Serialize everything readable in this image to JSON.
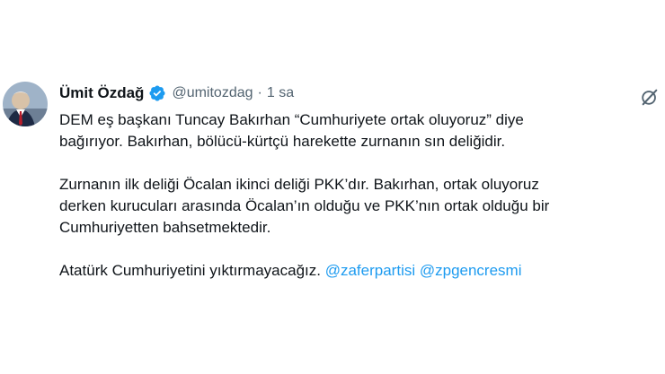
{
  "author": {
    "name": "Ümit Özdağ",
    "handle": "@umitozdag",
    "separator": "·",
    "time": "1 sa",
    "verified_color": "#1d9bf0"
  },
  "icons": {
    "avatar": "avatar-photo",
    "verified": "verified-badge-icon",
    "action": "grok-icon"
  },
  "tweet": {
    "paragraph1": [
      "DEM eş başkanı Tuncay Bakırhan “Cumhuriyete ortak oluyoruz” diye",
      "bağırıyor. Bakırhan, bölücü-kürtçü harekette zurnanın sın deliğidir."
    ],
    "paragraph2": [
      "Zurnanın ilk deliği Öcalan ikinci deliği PKK’dır. Bakırhan, ortak oluyoruz",
      "derken kurucuları arasında Öcalan’ın olduğu ve PKK’nın ortak olduğu bir",
      "Cumhuriyetten bahsetmektedir."
    ],
    "paragraph3": {
      "text": "Atatürk Cumhuriyetini yıktırmayacağız.",
      "mentions": [
        "@zaferpartisi",
        "@zpgencresmi"
      ]
    }
  },
  "colors": {
    "text": "#0f1419",
    "secondary": "#536471",
    "link": "#1d9bf0"
  }
}
